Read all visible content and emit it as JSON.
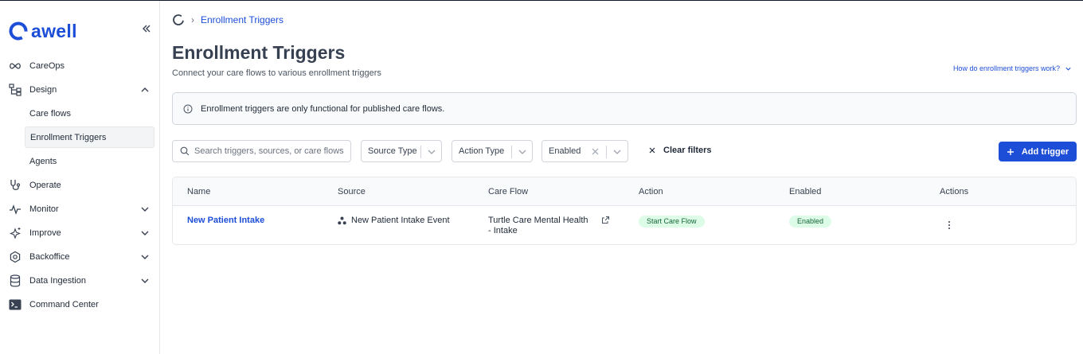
{
  "app": {
    "logo_text": "awell",
    "brand_color": "#1d4ed8"
  },
  "sidebar": {
    "items": [
      {
        "label": "CareOps",
        "icon": "infinity-icon"
      },
      {
        "label": "Design",
        "icon": "sitemap-icon",
        "expanded": true,
        "children": [
          {
            "label": "Care flows"
          },
          {
            "label": "Enrollment Triggers",
            "active": true
          },
          {
            "label": "Agents"
          }
        ]
      },
      {
        "label": "Operate",
        "icon": "stethoscope-icon"
      },
      {
        "label": "Monitor",
        "icon": "activity-icon",
        "expandable": true
      },
      {
        "label": "Improve",
        "icon": "sparkles-icon",
        "expandable": true
      },
      {
        "label": "Backoffice",
        "icon": "settings-icon",
        "expandable": true
      },
      {
        "label": "Data Ingestion",
        "icon": "database-icon",
        "expandable": true
      },
      {
        "label": "Command Center",
        "icon": "terminal-icon"
      }
    ]
  },
  "breadcrumb": {
    "current": "Enrollment Triggers"
  },
  "page": {
    "title": "Enrollment Triggers",
    "subtitle": "Connect your care flows to various enrollment triggers",
    "help_link": "How do enrollment triggers work?"
  },
  "banner": {
    "text": "Enrollment triggers are only functional for published care flows."
  },
  "filters": {
    "search_placeholder": "Search triggers, sources, or care flows",
    "source_type": "Source Type",
    "action_type": "Action Type",
    "enabled": "Enabled",
    "clear_label": "Clear filters",
    "add_label": "Add trigger"
  },
  "table": {
    "headers": [
      "Name",
      "Source",
      "Care Flow",
      "Action",
      "Enabled",
      "Actions"
    ],
    "rows": [
      {
        "name": "New Patient Intake",
        "source": "New Patient Intake Event",
        "care_flow_line1": "Turtle Care Mental Health",
        "care_flow_line2": "- Intake",
        "action": "Start Care Flow",
        "enabled": "Enabled"
      }
    ]
  },
  "colors": {
    "accent": "#1d4ed8",
    "pill_bg": "#dcfce7",
    "pill_text": "#166534"
  }
}
